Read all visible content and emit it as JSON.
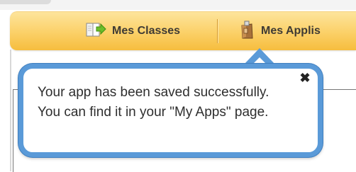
{
  "navbar": {
    "items": [
      {
        "label": "Mes Classes",
        "icon": "book-arrow-icon"
      },
      {
        "label": "Mes Applis",
        "icon": "bag-icon"
      }
    ]
  },
  "popover": {
    "message": "Your app has been saved successfully. You can find it in your \"My Apps\" page.",
    "close_label": "✖"
  },
  "colors": {
    "navbar_top": "#fde49c",
    "navbar_bottom": "#f6bd3e",
    "popover_border": "#5a9ad8",
    "text": "#2e2e2e"
  }
}
